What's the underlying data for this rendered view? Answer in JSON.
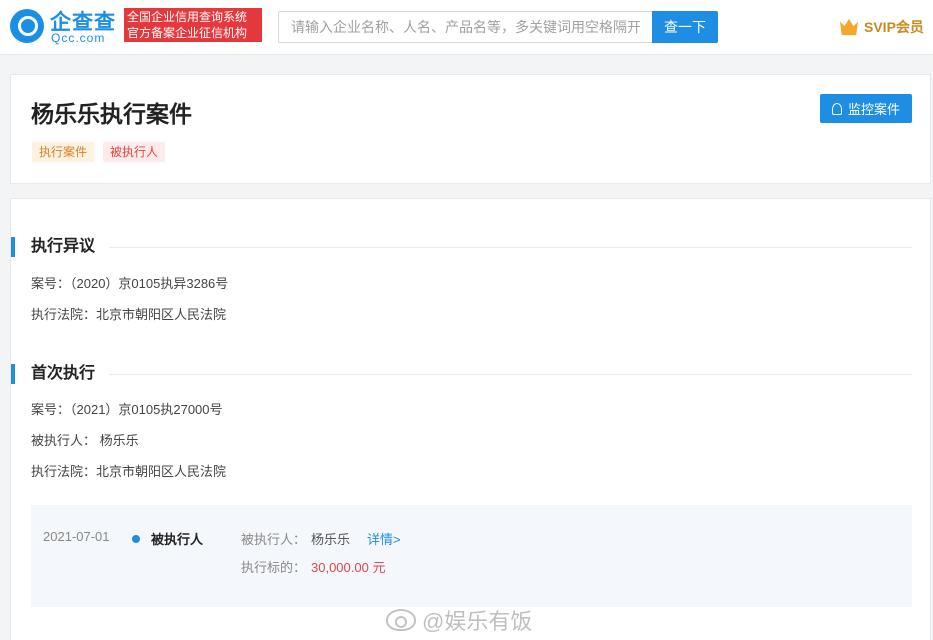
{
  "header": {
    "logo_cn": "企查查",
    "logo_en": "Qcc.com",
    "slogan_line1": "全国企业信用查询系统",
    "slogan_line2": "官方备案企业征信机构",
    "search_placeholder": "请输入企业名称、人名、产品名等，多关键词用空格隔开",
    "search_button": "查一下",
    "vip_label": "SVIP会员"
  },
  "title_card": {
    "title": "杨乐乐执行案件",
    "tags": [
      "执行案件",
      "被执行人"
    ],
    "monitor_button": "监控案件"
  },
  "sections": [
    {
      "title": "执行异议",
      "fields": [
        {
          "label": "案号：",
          "value": "（2020）京0105执异3286号"
        },
        {
          "label": "执行法院：",
          "value": "北京市朝阳区人民法院"
        }
      ]
    },
    {
      "title": "首次执行",
      "fields": [
        {
          "label": "案号：",
          "value": "（2021）京0105执27000号"
        },
        {
          "label": "被执行人：",
          "value": "杨乐乐"
        },
        {
          "label": "执行法院：",
          "value": "北京市朝阳区人民法院"
        }
      ]
    }
  ],
  "timeline": {
    "date": "2021-07-01",
    "role": "被执行人",
    "person_label": "被执行人：",
    "person_value": "杨乐乐",
    "details_link": "详情>",
    "amount_label": "执行标的：",
    "amount_value": "30,000.00 元"
  },
  "watermark": "@娱乐有饭",
  "colors": {
    "primary": "#1e8de4",
    "brand_red": "#e4383c",
    "amount_red": "#e04646",
    "vip_gold": "#c78a1d"
  }
}
